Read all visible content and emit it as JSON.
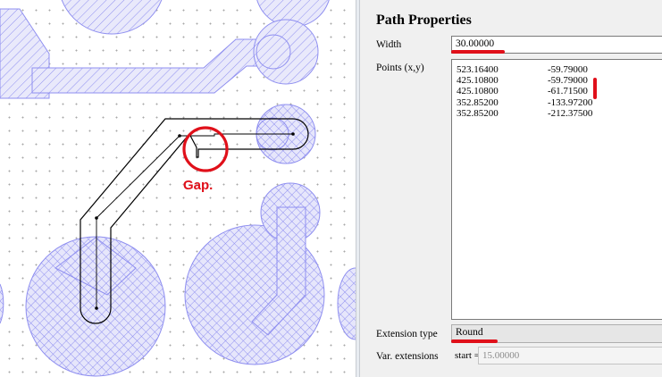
{
  "annotation": {
    "gap_label": "Gap."
  },
  "panel": {
    "title": "Path Properties",
    "width_label": "Width",
    "width_value": "30.00000",
    "points_label": "Points (x,y)",
    "points": [
      {
        "x": "523.16400",
        "y": "-59.79000"
      },
      {
        "x": "425.10800",
        "y": "-59.79000"
      },
      {
        "x": "425.10800",
        "y": "-61.71500"
      },
      {
        "x": "352.85200",
        "y": "-133.97200"
      },
      {
        "x": "352.85200",
        "y": "-212.37500"
      }
    ],
    "extension_label": "Extension type",
    "extension_value": "Round",
    "var_ext_label": "Var. extensions",
    "start_label": "start =",
    "start_value": "15.00000"
  },
  "colors": {
    "hatch": "#8f8ff0",
    "hatch_fill": "#e6e6fb",
    "annotation_red": "#e0101a"
  }
}
